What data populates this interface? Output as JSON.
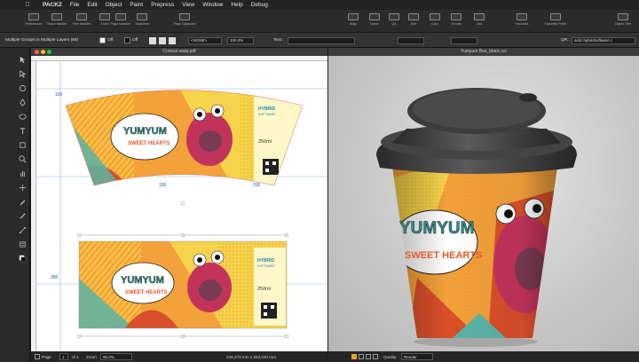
{
  "menubar": {
    "apple": "",
    "app": "PACKZ",
    "items": [
      "File",
      "Edit",
      "Object",
      "Paint",
      "Prepress",
      "View",
      "Window",
      "Help",
      "Debug"
    ]
  },
  "toolbar": {
    "buttons": [
      {
        "label": "Preferences",
        "icon": "gear-icon"
      },
      {
        "label": "Show Handles",
        "icon": "handles-icon"
      },
      {
        "label": "Hide Handles",
        "icon": "handles-icon"
      },
      {
        "label": "Zoom",
        "icon": "zoom-icon"
      },
      {
        "label": "Page Number",
        "icon": "page-icon"
      },
      {
        "label": "Swatches",
        "icon": "swatch-icon"
      },
      {
        "label": "Page Clipboard",
        "icon": "clipboard-icon"
      },
      {
        "label": "Align",
        "icon": "align-icon"
      },
      {
        "label": "Name",
        "icon": "tag-icon"
      },
      {
        "label": "QA",
        "icon": "check-icon"
      },
      {
        "label": "Edit",
        "icon": "edit-icon"
      },
      {
        "label": "Color",
        "icon": "color-icon"
      },
      {
        "label": "Arrows",
        "icon": "arrow-icon"
      },
      {
        "label": "Libs",
        "icon": "lib-icon"
      },
      {
        "label": "Favorites",
        "icon": "star-icon"
      },
      {
        "label": "Favorites Panel",
        "icon": "star-icon"
      },
      {
        "label": "Object Tree",
        "icon": "tree-icon"
      }
    ]
  },
  "optionbar": {
    "selection": "Multiple Groups in Multiple Layers (68)",
    "fill_label": "Off",
    "stroke_label": "Off",
    "mode": "<NONE>",
    "opacity": "100.0%",
    "text_label": "Text:",
    "qr_label": "QR:",
    "qr_value": "ackz.hybridsoftware.c"
  },
  "document": {
    "title": "Conical warp.pdf",
    "ruler_labels": {
      "v_top": "100",
      "h_mid": "190",
      "h_right": "200",
      "v_bottom": "300"
    },
    "design": {
      "brand1": "YUMYUM",
      "brand2": "SWEET HEARTS",
      "hybrid": "HYBRID",
      "software": "SOFTWARE",
      "volume": "250ml"
    }
  },
  "status": {
    "page_label": "Page",
    "page_num": "1",
    "page_of": "of 1",
    "zoom_label": "Zoom",
    "zoom_value": "95.0%",
    "coords": "249,273 mm x 263,040 mm"
  },
  "view3d": {
    "title": "Yumyum Box_black.xcr",
    "quality_label": "Quality",
    "quality_value": "Render"
  },
  "colors": {
    "cup_lid": "#3d3d3d",
    "accent_orange": "#f3a13a",
    "accent_teal": "#5ab3a5",
    "accent_pink": "#c2335c",
    "accent_yellow": "#f5d34a"
  }
}
